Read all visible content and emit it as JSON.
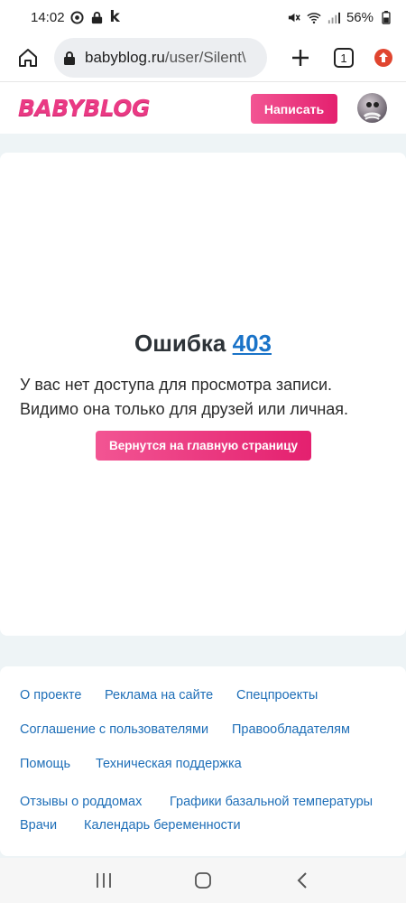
{
  "status": {
    "time": "14:02",
    "battery": "56%"
  },
  "browser": {
    "url_host": "babyblog.ru",
    "url_path": "/user/Silent\\",
    "tab_count": "1"
  },
  "site": {
    "logo": "BABYBLOG",
    "write_label": "Написать"
  },
  "error": {
    "title_word": "Ошибка",
    "code": "403",
    "message": "У вас нет доступа для просмотра записи. Видимо она только для друзей или личная.",
    "home_button": "Вернутся на главную страницу"
  },
  "footer": {
    "links": [
      "О проекте",
      "Реклама на сайте",
      "Спецпроекты",
      "Соглашение с пользователями",
      "Правообладателям",
      "Помощь",
      "Техническая поддержка",
      "Отзывы о роддомах",
      "Графики базальной температуры",
      "Врачи",
      "Календарь беременности"
    ]
  },
  "colors": {
    "brand_pink": "#ea3a84",
    "link_blue": "#1f6fb8",
    "page_bg": "#eef4f6"
  }
}
